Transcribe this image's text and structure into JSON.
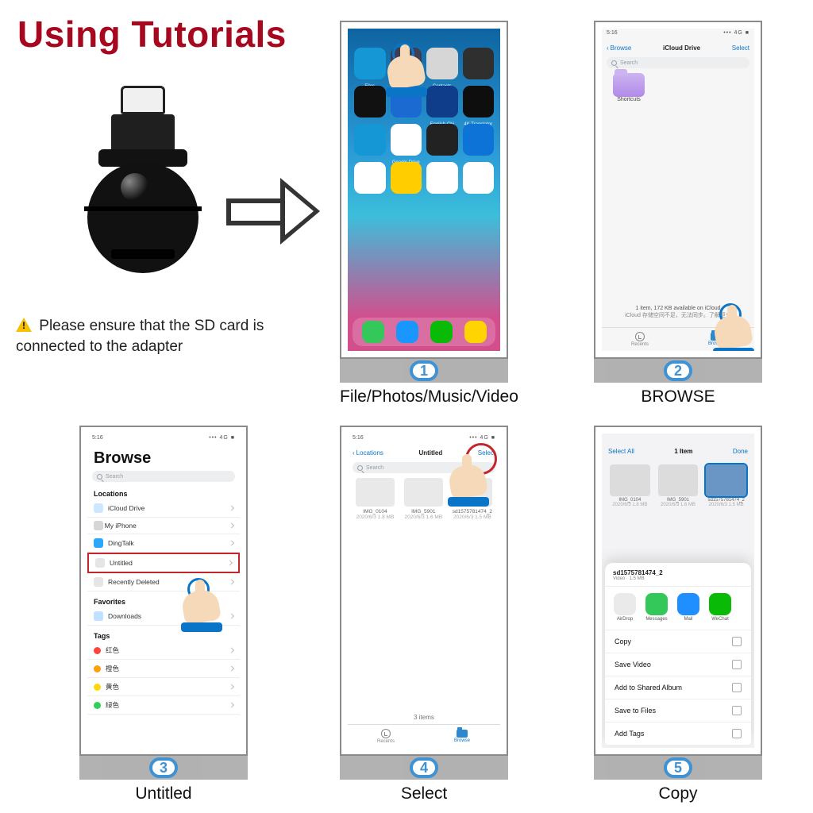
{
  "title": "Using Tutorials",
  "note": "Please ensure that the SD card is connected to the adapter",
  "steps": {
    "s1": {
      "num": "1",
      "caption": "File/Photos/Music/Video"
    },
    "s2": {
      "num": "2",
      "caption": "BROWSE"
    },
    "s3": {
      "num": "3",
      "caption": "Untitled"
    },
    "s4": {
      "num": "4",
      "caption": "Select"
    },
    "s5": {
      "num": "5",
      "caption": "Copy"
    }
  },
  "status_time": "5:16",
  "phone1": {
    "app_labels": [
      "Files",
      "Shortcuts",
      "Contacts",
      "",
      "",
      "English Chi",
      "4K Translator",
      "",
      "Google Drive",
      "",
      "",
      "",
      "",
      "",
      "",
      ""
    ],
    "dock": [
      "",
      "",
      "",
      ""
    ]
  },
  "phone2": {
    "back": "Browse",
    "title": "iCloud Drive",
    "select": "Select",
    "search_ph": "Search",
    "folder_label": "Shortcuts",
    "bottom_line1": "1 item, 172 KB available on iCloud",
    "bottom_line2": "iCloud 存储空间不足，无法同步。了解更多",
    "tab_recents": "Recents",
    "tab_browse": "Browse"
  },
  "phone3": {
    "title": "Browse",
    "search_ph": "Search",
    "sec_locations": "Locations",
    "rows": {
      "icloud": "iCloud Drive",
      "onmy": "On My iPhone",
      "ding": "DingTalk",
      "untitled": "Untitled",
      "deleted": "Recently Deleted"
    },
    "sec_fav": "Favorites",
    "fav_downloads": "Downloads",
    "sec_tags": "Tags",
    "tags": [
      "红色",
      "橙色",
      "黄色",
      "绿色"
    ]
  },
  "phone4": {
    "back": "Locations",
    "title": "Untitled",
    "select": "Select",
    "files": [
      {
        "name": "IMG_0104",
        "meta": "2020/6/3\n1.8 MB"
      },
      {
        "name": "IMG_5901",
        "meta": "2020/6/3\n1.6 MB"
      },
      {
        "name": "sd1575781474_2",
        "meta": "2020/6/3\n1.5 MB"
      }
    ],
    "count": "3 items",
    "tab_recents": "Recents",
    "tab_browse": "Browse"
  },
  "phone5": {
    "select_all": "Select All",
    "title": "1 Item",
    "done": "Done",
    "thumbs": [
      {
        "name": "IMG_0104",
        "meta": "2020/6/3\n1.8 MB"
      },
      {
        "name": "IMG_5901",
        "meta": "2020/6/3\n1.6 MB"
      },
      {
        "name": "sd1575781474_2",
        "meta": "2020/6/3\n1.5 MB"
      }
    ],
    "panel_name": "sd1575781474_2",
    "panel_sub": "Video · 1.5 MB",
    "share_apps": [
      {
        "label": "AirDrop",
        "color": "#eaeaea"
      },
      {
        "label": "Messages",
        "color": "#34c759"
      },
      {
        "label": "Mail",
        "color": "#1f8fff"
      },
      {
        "label": "WeChat",
        "color": "#09bb07"
      }
    ],
    "actions": [
      "Copy",
      "Save Video",
      "Add to Shared Album",
      "Save to Files",
      "Add Tags"
    ]
  }
}
